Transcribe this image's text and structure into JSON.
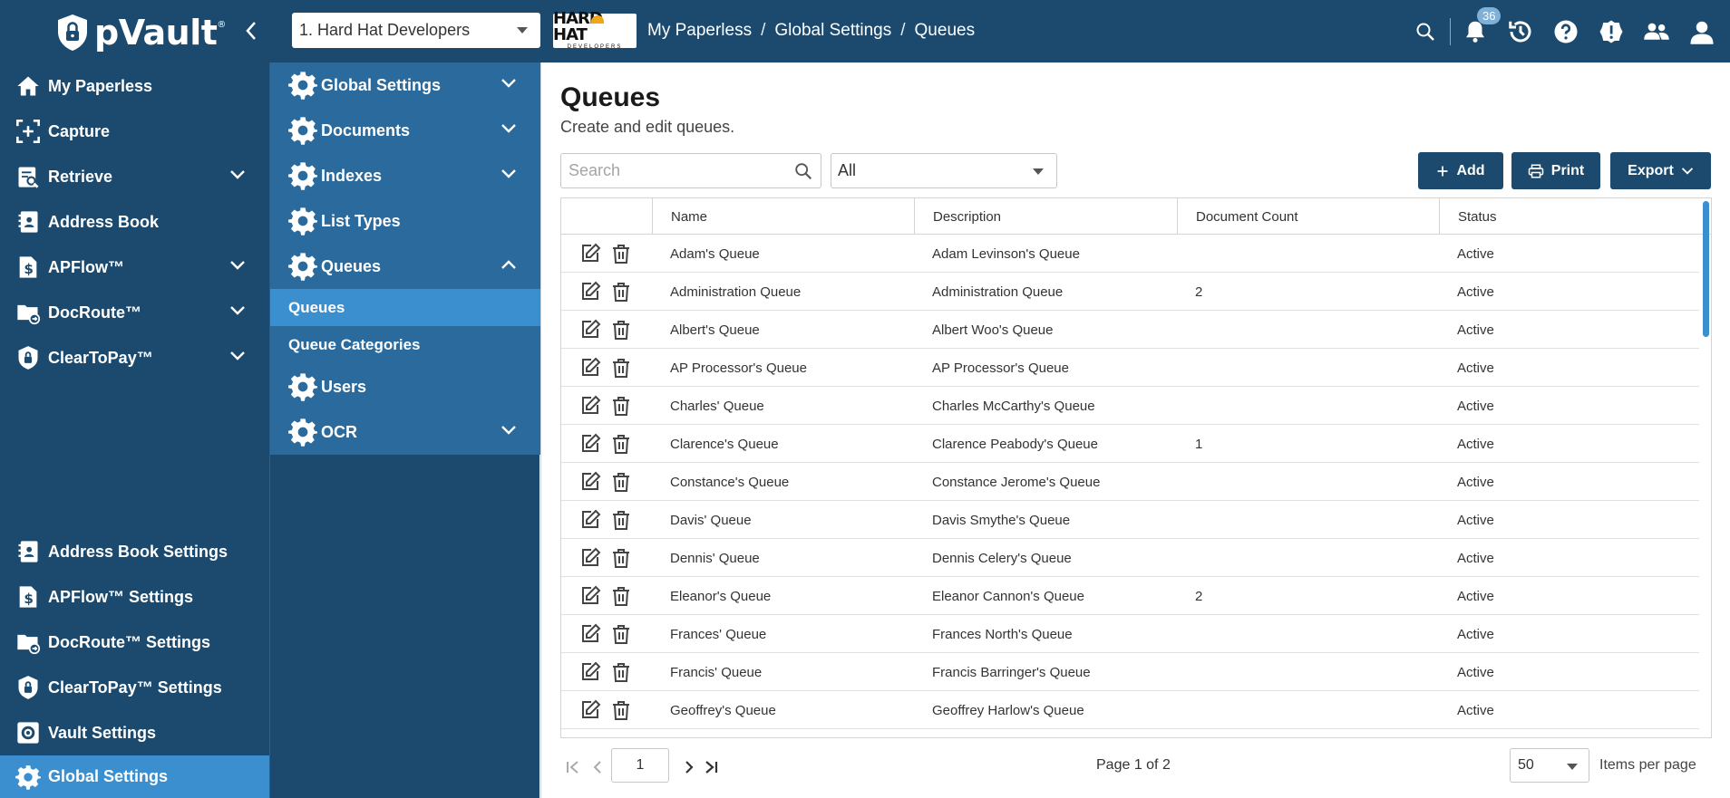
{
  "app": {
    "brand": "pVault",
    "trademark": "®"
  },
  "header": {
    "company": "1. Hard Hat Developers",
    "logo": {
      "line1": "HARD HAT",
      "line2": "DEVELOPERS"
    },
    "breadcrumb": [
      "My Paperless",
      "Global Settings",
      "Queues"
    ],
    "breadcrumb_sep": "/",
    "notification_count": "36"
  },
  "leftnav": {
    "items": [
      {
        "label": "My Paperless",
        "icon": "home-icon"
      },
      {
        "label": "Capture",
        "icon": "capture-icon"
      },
      {
        "label": "Retrieve",
        "icon": "retrieve-icon",
        "expandable": true
      },
      {
        "label": "Address Book",
        "icon": "address-book-icon"
      },
      {
        "label": "APFlow™",
        "icon": "apflow-icon",
        "expandable": true
      },
      {
        "label": "DocRoute™",
        "icon": "docroute-icon",
        "expandable": true
      },
      {
        "label": "ClearToPay™",
        "icon": "cleartopay-icon",
        "expandable": true
      }
    ],
    "settings": [
      {
        "label": "Address Book Settings",
        "icon": "address-book-icon"
      },
      {
        "label": "APFlow™ Settings",
        "icon": "apflow-icon"
      },
      {
        "label": "DocRoute™ Settings",
        "icon": "docroute-icon"
      },
      {
        "label": "ClearToPay™ Settings",
        "icon": "cleartopay-icon"
      },
      {
        "label": "Vault Settings",
        "icon": "gear-icon"
      },
      {
        "label": "Global Settings",
        "icon": "gear-icon",
        "active": true
      }
    ]
  },
  "subnav": {
    "items": [
      {
        "label": "Global Settings"
      },
      {
        "label": "Documents"
      },
      {
        "label": "Indexes"
      },
      {
        "label": "List Types"
      },
      {
        "label": "Queues"
      }
    ],
    "children": [
      {
        "label": "Queues",
        "active": true
      },
      {
        "label": "Queue Categories"
      }
    ],
    "after": [
      {
        "label": "Users"
      },
      {
        "label": "OCR"
      }
    ]
  },
  "main": {
    "title": "Queues",
    "subtitle": "Create and edit queues.",
    "search_placeholder": "Search",
    "filter_value": "All",
    "add_label": "Add",
    "print_label": "Print",
    "export_label": "Export",
    "columns": [
      "Name",
      "Description",
      "Document Count",
      "Status"
    ],
    "rows": [
      {
        "name": "Adam's Queue",
        "description": "Adam Levinson's Queue",
        "count": "",
        "status": "Active"
      },
      {
        "name": "Administration Queue",
        "description": "Administration Queue",
        "count": "2",
        "status": "Active"
      },
      {
        "name": "Albert's Queue",
        "description": "Albert Woo's Queue",
        "count": "",
        "status": "Active"
      },
      {
        "name": "AP Processor's Queue",
        "description": "AP Processor's Queue",
        "count": "",
        "status": "Active"
      },
      {
        "name": "Charles' Queue",
        "description": "Charles McCarthy's Queue",
        "count": "",
        "status": "Active"
      },
      {
        "name": "Clarence's Queue",
        "description": "Clarence Peabody's Queue",
        "count": "1",
        "status": "Active"
      },
      {
        "name": "Constance's Queue",
        "description": "Constance Jerome's Queue",
        "count": "",
        "status": "Active"
      },
      {
        "name": "Davis' Queue",
        "description": "Davis Smythe's Queue",
        "count": "",
        "status": "Active"
      },
      {
        "name": "Dennis' Queue",
        "description": "Dennis Celery's Queue",
        "count": "",
        "status": "Active"
      },
      {
        "name": "Eleanor's Queue",
        "description": "Eleanor Cannon's Queue",
        "count": "2",
        "status": "Active"
      },
      {
        "name": "Frances' Queue",
        "description": "Frances North's Queue",
        "count": "",
        "status": "Active"
      },
      {
        "name": "Francis' Queue",
        "description": "Francis Barringer's Queue",
        "count": "",
        "status": "Active"
      },
      {
        "name": "Geoffrey's Queue",
        "description": "Geoffrey Harlow's Queue",
        "count": "",
        "status": "Active"
      }
    ],
    "pager": {
      "page": "1",
      "label": "Page 1 of 2",
      "page_size": "50",
      "items_per_page_label": "Items per page"
    }
  },
  "colors": {
    "nav": "#1b4a6e",
    "subnav_panel": "#2a6a9c",
    "accent": "#3c8fcf"
  }
}
